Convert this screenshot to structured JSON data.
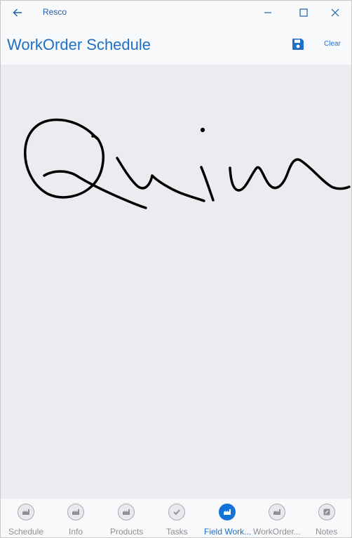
{
  "titlebar": {
    "app_name": "Resco",
    "icons": {
      "back": "back-arrow-icon",
      "minimize": "minimize-icon",
      "maximize": "maximize-icon",
      "close": "close-icon"
    }
  },
  "header": {
    "title": "WorkOrder Schedule",
    "save_icon": "save-disk-icon",
    "clear_label": "Clear"
  },
  "canvas": {
    "content": "handwritten signature strokes"
  },
  "tabs": [
    {
      "label": "Schedule",
      "icon": "factory-icon",
      "active": false
    },
    {
      "label": "Info",
      "icon": "factory-icon",
      "active": false
    },
    {
      "label": "Products",
      "icon": "factory-icon",
      "active": false
    },
    {
      "label": "Tasks",
      "icon": "checkmark-icon",
      "active": false
    },
    {
      "label": "Field Work...",
      "icon": "factory-icon",
      "active": true
    },
    {
      "label": "WorkOrder...",
      "icon": "factory-icon",
      "active": false
    },
    {
      "label": "Notes",
      "icon": "note-edit-icon",
      "active": false
    }
  ],
  "colors": {
    "accent": "#1f6fc4",
    "active_tab": "#1373d9",
    "canvas_bg": "#ebecef",
    "inactive_label": "#8f8f93"
  }
}
